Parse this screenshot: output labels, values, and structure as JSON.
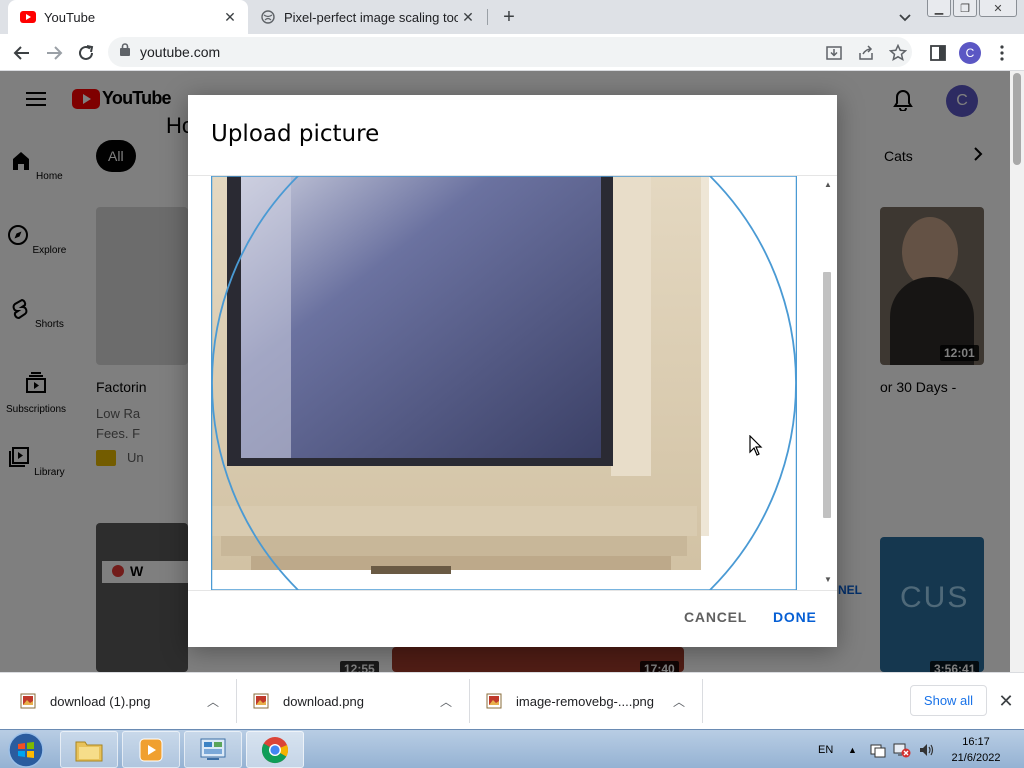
{
  "browser": {
    "tabs": [
      {
        "title": "YouTube",
        "active": true
      },
      {
        "title": "Pixel-perfect image scaling tool",
        "active": false
      }
    ],
    "url": "youtube.com",
    "profile_initial": "C"
  },
  "youtube": {
    "logo_text": "YouTube",
    "heading_partial": "Ho",
    "chips": [
      "All",
      "Cats"
    ],
    "sidebar": [
      "Home",
      "Explore",
      "Shorts",
      "Subscriptions",
      "Library"
    ],
    "video_titles": [
      "Factorin",
      "or 30 Days -"
    ],
    "video_meta": [
      "Low Ra",
      "Fees. F"
    ],
    "channel_partial": "Un",
    "durations": [
      "12:01",
      "12:55",
      "17:40",
      "3:56:41"
    ],
    "overlay_text": [
      "NEL",
      "CUS",
      "W"
    ],
    "avatar_initial": "C"
  },
  "modal": {
    "title": "Upload picture",
    "cancel_label": "CANCEL",
    "done_label": "DONE"
  },
  "downloads": {
    "items": [
      "download (1).png",
      "download.png",
      "image-removebg-....png"
    ],
    "show_all_label": "Show all"
  },
  "taskbar": {
    "language": "EN",
    "time": "16:17",
    "date": "21/6/2022"
  }
}
